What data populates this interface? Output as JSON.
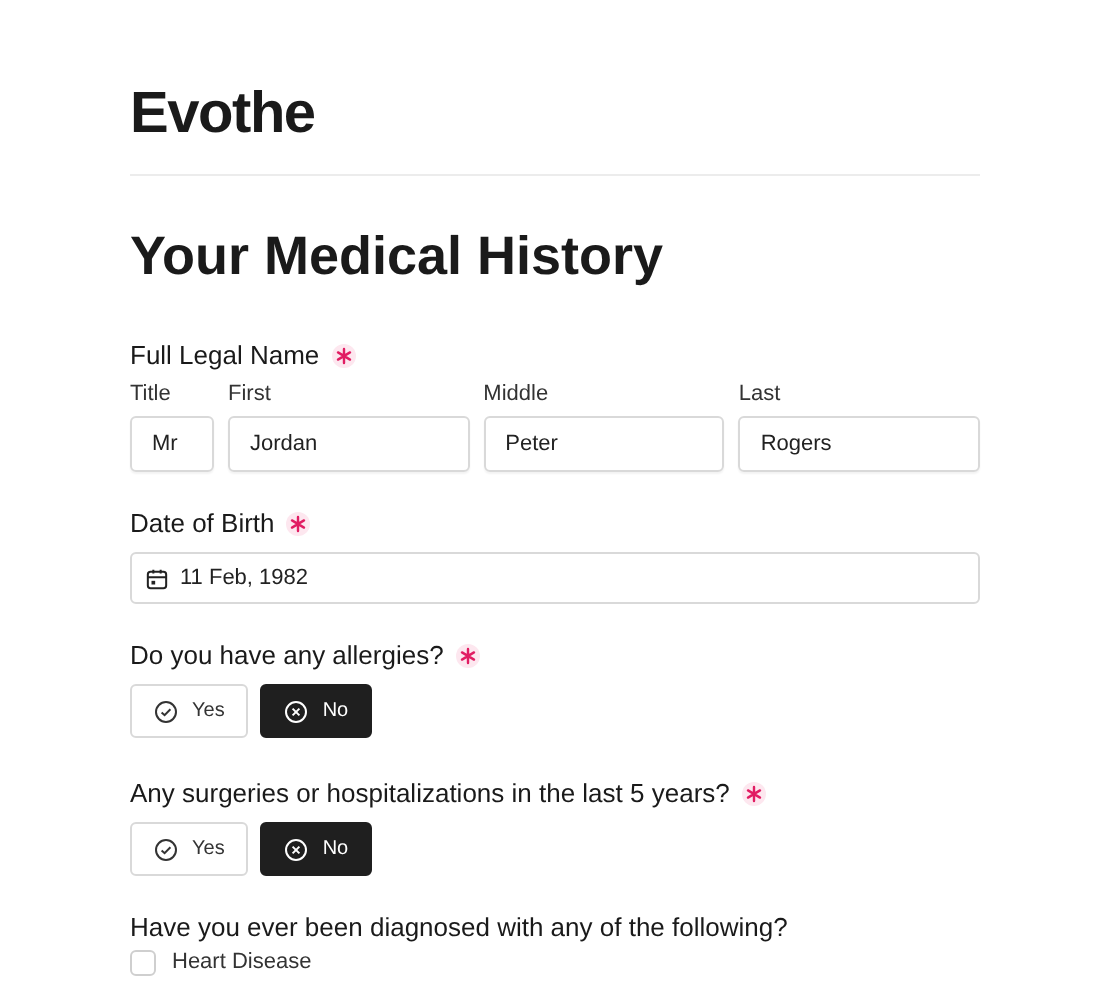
{
  "logo": "Evothe",
  "title": "Your Medical History",
  "name_section": {
    "label": "Full Legal Name",
    "required": true,
    "fields": [
      {
        "label": "Title",
        "value": "Mr"
      },
      {
        "label": "First",
        "value": "Jordan"
      },
      {
        "label": "Middle",
        "value": "Peter"
      },
      {
        "label": "Last",
        "value": "Rogers"
      }
    ]
  },
  "date_of_birth": {
    "label": "Date of Birth",
    "required": true,
    "value": "11 Feb, 1982"
  },
  "questions": [
    {
      "label": "Do you have any allergies?",
      "required": true,
      "options": [
        {
          "kind": "yes",
          "label": "Yes",
          "selected": false
        },
        {
          "kind": "no",
          "label": "No",
          "selected": true
        }
      ]
    },
    {
      "label": "Any surgeries or hospitalizations in the last 5 years?",
      "required": true,
      "options": [
        {
          "kind": "yes",
          "label": "Yes",
          "selected": false
        },
        {
          "kind": "no",
          "label": "No",
          "selected": true
        }
      ]
    }
  ],
  "conditions": {
    "label": "Have you ever been diagnosed with any of the following?",
    "items": [
      {
        "label": "Heart Disease",
        "checked": false
      }
    ]
  }
}
